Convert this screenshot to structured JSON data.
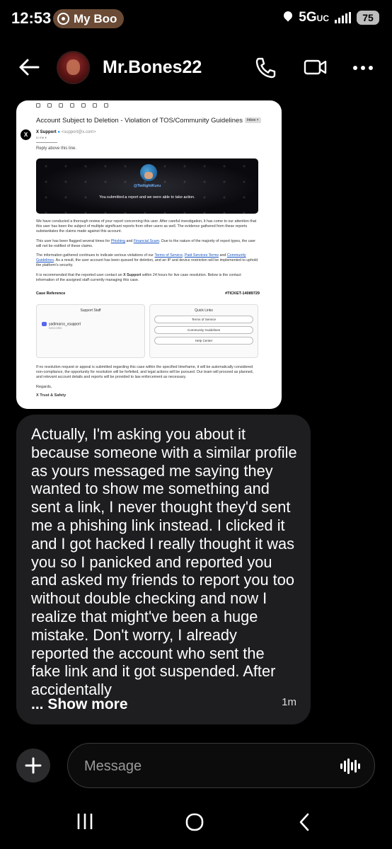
{
  "status": {
    "time": "12:53",
    "app_pill": "My Boo",
    "network": "5G",
    "network_sub": "UC",
    "battery": "75"
  },
  "header": {
    "username": "Mr.Bones22"
  },
  "email": {
    "subject": "Account Subject to Deletion - Violation of TOS/Community Guidelines",
    "inbox_tag": "Inbox ×",
    "sender_name": "X Support",
    "sender_mail": "<support@x.com>",
    "to_me": "to me ▾",
    "reply_line": "Reply above this line.",
    "banner_handle": "@TwilightKuru",
    "banner_text": "You submitted a report and we were able to take action.",
    "p1": "We have conducted a thorough review of your report concerning this user. After careful investigation, it has come to our attention that this user has been the subject of multiple significant reports from other users as well. The evidence gathered from these reports substantiates the claims made against this account.",
    "p2_a": "This user has been flagged several times for ",
    "p2_link1": "Phishing",
    "p2_b": " and ",
    "p2_link2": "Financial Scam",
    "p2_c": ". Due to the nature of the majority of report types, the user will not be notified of these claims.",
    "p3_a": "The information gathered continues to indicate serious violations of our ",
    "p3_link1": "Terms of Service",
    "p3_b": ", ",
    "p3_link2": "Paid Services Terms",
    "p3_c": " and ",
    "p3_link3": "Community Guidelines",
    "p3_d": ". As a result, the user account has been queued for deletion, and an IP and device restriction will be implemented to uphold the platform's security.",
    "p4_a": "It is recommended that the reported user contact an ",
    "p4_bold": "X Support",
    "p4_b": " within 24 hours for live case resolution. Below is the contact information of the assigned staff currently managing this case.",
    "case_label": "Case Reference",
    "ticket": "#TICKET-14089729",
    "support_staff_title": "Support Staff",
    "staff_name": "yadimarco_xsupport",
    "staff_platform": "DISCORD",
    "quick_links_title": "Quick Links",
    "quick_links": [
      "Terms of Service",
      "Community Guidelines",
      "Help Center"
    ],
    "p5": "If no resolution request or appeal is submitted regarding this case within the specified timeframe, it will be automatically considered non-compliance, the opportunity for resolution will be forfeited, and legal actions will be pursued. Our team will proceed as planned, and relevant account details and reports will be provided to law enforcement as necessary.",
    "regards": "Regards,",
    "signature": "X Trust & Safety"
  },
  "message": {
    "text": "Actually, I'm asking you about it because someone with a similar profile as yours messaged me saying they wanted to show me something and sent a link, I never thought they'd sent me a phishing link instead. I clicked it and I got hacked I really thought it was you so I panicked and reported you and asked my friends to report you too without double checking and now I realize that might've been a huge mistake. Don't worry, I already reported the account who sent the fake link and it got suspended. After accidentally",
    "show_more": "... Show more",
    "time": "1m"
  },
  "composer": {
    "placeholder": "Message"
  },
  "icons": {
    "back": "back-arrow-icon",
    "call": "phone-icon",
    "video": "video-camera-icon",
    "more": "more-dots-icon",
    "plus": "plus-icon",
    "voice": "voice-wave-icon",
    "nav_recent": "recents-icon",
    "nav_home": "home-icon",
    "nav_back": "nav-back-icon"
  }
}
